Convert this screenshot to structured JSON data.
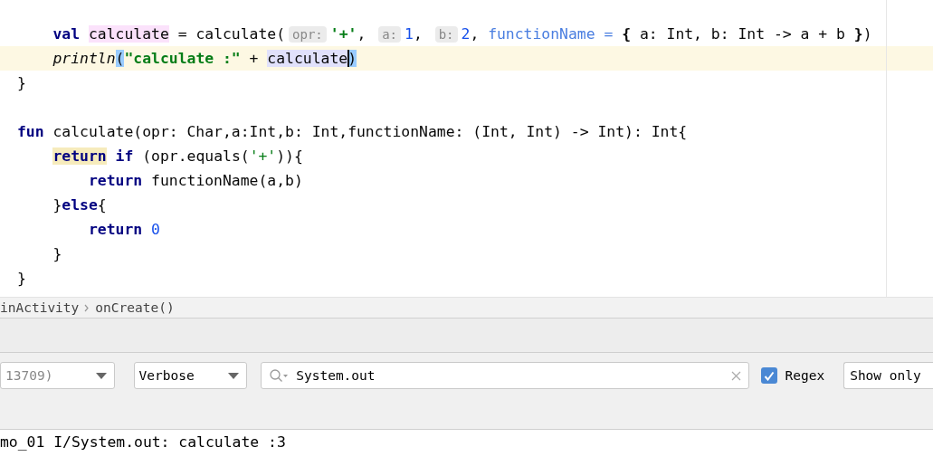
{
  "editor": {
    "lines": [
      {
        "current": false,
        "tokens": [
          {
            "text": "    val",
            "kind": "keyword"
          },
          {
            "text": " calculate",
            "kind": "declaration"
          },
          {
            "text": " = calculate(",
            "kind": "plain"
          },
          {
            "text": "opr:",
            "kind": "hint"
          },
          {
            "text": "'+'",
            "kind": "string"
          },
          {
            "text": ", ",
            "kind": "plain"
          },
          {
            "text": "a:",
            "kind": "hint"
          },
          {
            "text": "1",
            "kind": "number"
          },
          {
            "text": ", ",
            "kind": "plain"
          },
          {
            "text": "b:",
            "kind": "hint"
          },
          {
            "text": "2",
            "kind": "number"
          },
          {
            "text": ", ",
            "kind": "plain"
          },
          {
            "text": "functionName =",
            "kind": "param"
          },
          {
            "text": " {",
            "kind": "brace"
          },
          {
            "text": " a: Int, b: Int -> a + b ",
            "kind": "plain"
          },
          {
            "text": "}",
            "kind": "brace"
          },
          {
            "text": ")",
            "kind": "plain"
          }
        ]
      },
      {
        "current": true,
        "tokens": [
          {
            "text": "    println",
            "kind": "function"
          },
          {
            "text": "(",
            "kind": "paren"
          },
          {
            "text": "\"calculate :\"",
            "kind": "string"
          },
          {
            "text": " + ",
            "kind": "plain"
          },
          {
            "text": "calculate",
            "kind": "usage"
          },
          {
            "text": ")",
            "kind": "paren-caret"
          }
        ]
      },
      {
        "current": false,
        "tokens": [
          {
            "text": "}",
            "kind": "plain"
          }
        ]
      },
      {
        "current": false
      },
      {
        "current": false,
        "tokens": [
          {
            "text": "fun",
            "kind": "keyword"
          },
          {
            "text": " calculate(opr: Char,a:Int,b: Int,functionName: (Int, Int) -> Int): Int{",
            "kind": "plain"
          }
        ]
      },
      {
        "current": false,
        "tokens": [
          {
            "text": "    return",
            "kind": "keyword-marked"
          },
          {
            "text": " if",
            "kind": "keyword"
          },
          {
            "text": " (opr.equals(",
            "kind": "plain"
          },
          {
            "text": "'+'",
            "kind": "string-plain"
          },
          {
            "text": ")){",
            "kind": "plain"
          }
        ]
      },
      {
        "current": false,
        "tokens": [
          {
            "text": "        return",
            "kind": "keyword"
          },
          {
            "text": " functionName(a,b)",
            "kind": "plain"
          }
        ]
      },
      {
        "current": false,
        "tokens": [
          {
            "text": "    }",
            "kind": "plain"
          },
          {
            "text": "else",
            "kind": "keyword"
          },
          {
            "text": "{",
            "kind": "plain"
          }
        ]
      },
      {
        "current": false,
        "tokens": [
          {
            "text": "        return",
            "kind": "keyword"
          },
          {
            "text": " 0",
            "kind": "number"
          }
        ]
      },
      {
        "current": false,
        "tokens": [
          {
            "text": "    }",
            "kind": "plain"
          }
        ]
      },
      {
        "current": false,
        "tokens": [
          {
            "text": "}",
            "kind": "plain"
          }
        ]
      }
    ]
  },
  "breadcrumb": [
    "inActivity",
    "onCreate()"
  ],
  "logcat": {
    "process": "13709)",
    "level": "Verbose",
    "search": "System.out",
    "regex": {
      "label": "Regex",
      "checked": true
    },
    "filter": "Show only"
  },
  "log": [
    "mo_01 I/System.out: calculate :3"
  ]
}
